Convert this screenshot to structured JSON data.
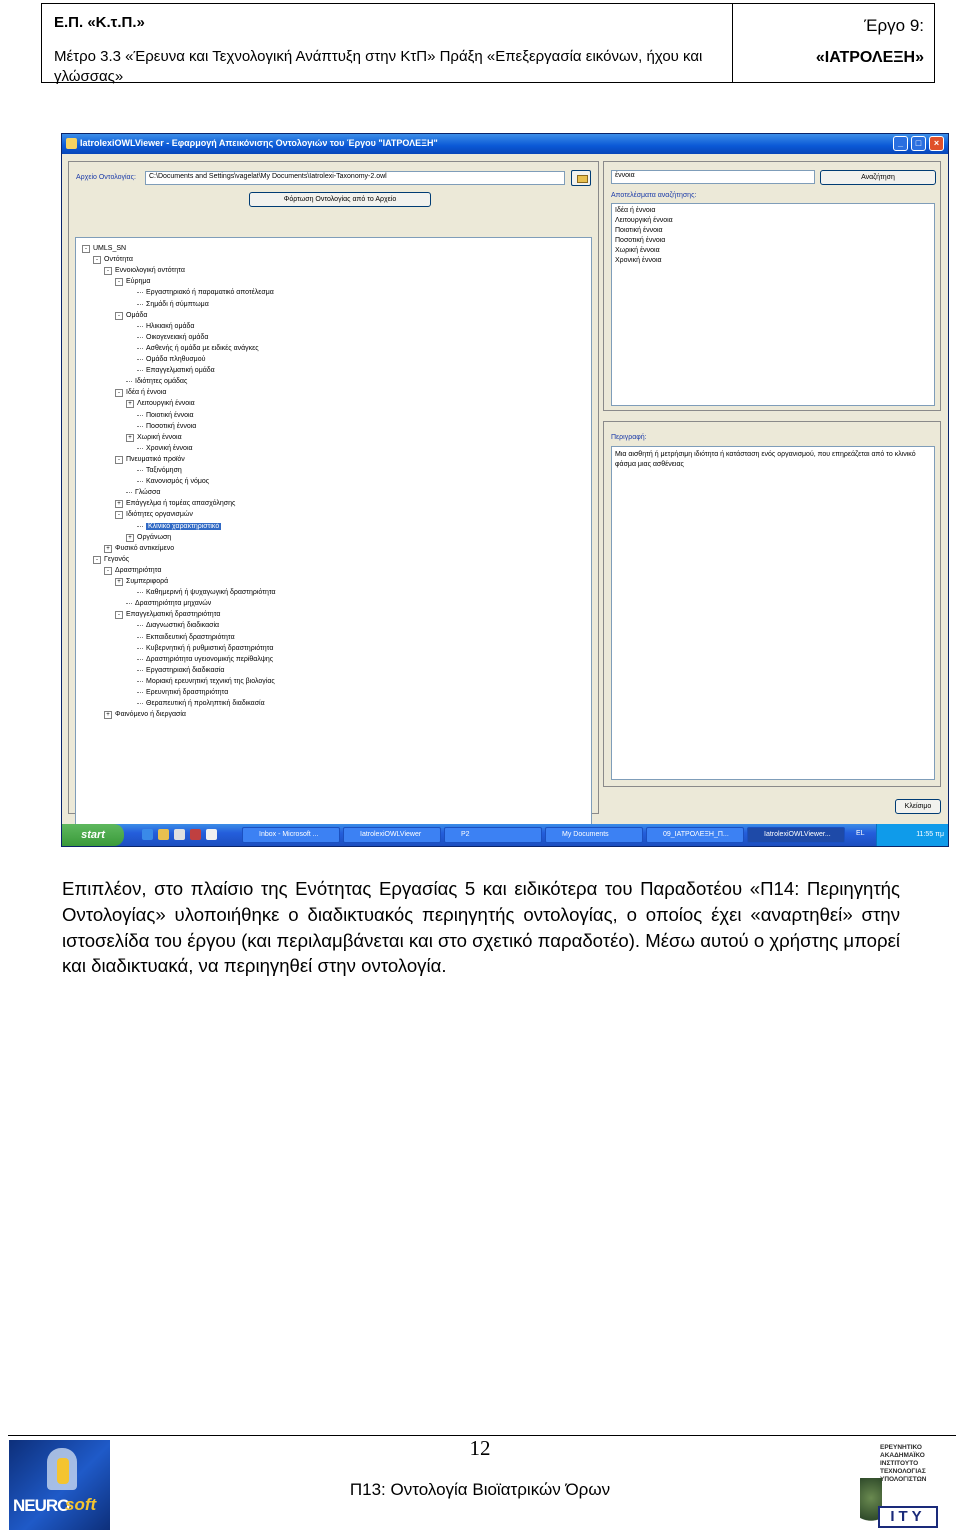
{
  "header": {
    "left_title": "Ε.Π. «Κ.τ.Π.»",
    "left_subtitle": "Μέτρο 3.3 «Έρευνα και Τεχνολογική Ανάπτυξη στην ΚτΠ» Πράξη «Επεξεργασία εικόνων, ήχου και γλώσσας»",
    "right_top": "Έργο 9:",
    "right_bottom": "«ΙΑΤΡΟΛΕΞΗ»"
  },
  "app": {
    "title": "IatrolexiOWLViewer - Εφαρμογή Απεικόνισης Οντολογιών του Έργου \"ΙΑΤΡΟΛΕΞΗ\"",
    "file_label": "Αρχείο Οντολογίας:",
    "file_path": "C:\\Documents and Settings\\vagelat\\My Documents\\Iatrolexi-Taxonomy-2.owl",
    "load_button": "Φόρτωση Οντολογίας από το Αρχείο",
    "search_value": "έννοια",
    "search_button": "Αναζήτηση",
    "results_label": "Αποτελέσματα αναζήτησης:",
    "results": [
      "Ιδέα ή έννοια",
      "Λειτουργική έννοια",
      "Ποιοτική έννοια",
      "Ποσοτική έννοια",
      "Χωρική έννοια",
      "Χρονική έννοια"
    ],
    "description_label": "Περιγραφή:",
    "description_text": "Μια αισθητή ή μετρήσιμη ιδιότητα ή κατάσταση ενός οργανισμού, που επηρεάζεται από το κλινικό φάσμα μιας ασθένειας",
    "close_button": "Κλείσιμο",
    "tree": [
      {
        "label": "UMLS_SN",
        "exp": "-"
      },
      {
        "label": "Οντότητα",
        "exp": "-"
      },
      {
        "label": "Εννοιολογική οντότητα",
        "exp": "-"
      },
      {
        "label": "Εύρημα",
        "exp": "-"
      },
      {
        "label": "Εργαστηριακό ή παραματικό αποτέλεσμα",
        "exp": ""
      },
      {
        "label": "Σημάδι ή σύμπτωμα",
        "exp": ""
      },
      {
        "label": "Ομάδα",
        "exp": "-"
      },
      {
        "label": "Ηλικιακή ομάδα",
        "exp": ""
      },
      {
        "label": "Οικογενειακή ομάδα",
        "exp": ""
      },
      {
        "label": "Ασθενής ή ομάδα με ειδικές ανάγκες",
        "exp": ""
      },
      {
        "label": "Ομάδα πληθυσμού",
        "exp": ""
      },
      {
        "label": "Επαγγελματική ομάδα",
        "exp": ""
      },
      {
        "label": "Ιδιότητες ομάδας",
        "exp": ""
      },
      {
        "label": "Ιδέα ή έννοια",
        "exp": "-"
      },
      {
        "label": "Λειτουργική έννοια",
        "exp": "+"
      },
      {
        "label": "Ποιοτική έννοια",
        "exp": ""
      },
      {
        "label": "Ποσοτική έννοια",
        "exp": ""
      },
      {
        "label": "Χωρική έννοια",
        "exp": "+"
      },
      {
        "label": "Χρονική έννοια",
        "exp": ""
      },
      {
        "label": "Πνευματικό προϊόν",
        "exp": "-"
      },
      {
        "label": "Ταξινόμηση",
        "exp": ""
      },
      {
        "label": "Κανονισμός ή νόμος",
        "exp": ""
      },
      {
        "label": "Γλώσσα",
        "exp": ""
      },
      {
        "label": "Επάγγελμα ή τομέας απασχόλησης",
        "exp": "+"
      },
      {
        "label": "Ιδιότητες οργανισμών",
        "exp": "-"
      },
      {
        "label": "Κλινικό χαρακτηριστικό",
        "exp": "",
        "selected": true
      },
      {
        "label": "Οργάνωση",
        "exp": "+"
      },
      {
        "label": "Φυσικό αντικείμενο",
        "exp": "+"
      },
      {
        "label": "Γεγονός",
        "exp": "-"
      },
      {
        "label": "Δραστηριότητα",
        "exp": "-"
      },
      {
        "label": "Συμπεριφορά",
        "exp": "+"
      },
      {
        "label": "Καθημερινή ή ψυχαγωγική δραστηριότητα",
        "exp": ""
      },
      {
        "label": "Δραστηριότητα μηχανών",
        "exp": ""
      },
      {
        "label": "Επαγγελματική δραστηριότητα",
        "exp": "-"
      },
      {
        "label": "Διαγνωστική διαδικασία",
        "exp": ""
      },
      {
        "label": "Εκπαιδευτική δραστηριότητα",
        "exp": ""
      },
      {
        "label": "Κυβερνητική ή ρυθμιστική δραστηριότητα",
        "exp": ""
      },
      {
        "label": "Δραστηριότητα υγειονομικής περίθαλψης",
        "exp": ""
      },
      {
        "label": "Εργαστηριακή διαδικασία",
        "exp": ""
      },
      {
        "label": "Μοριακή ερευνητική τεχνική της βιολογίας",
        "exp": ""
      },
      {
        "label": "Ερευνητική δραστηριότητα",
        "exp": ""
      },
      {
        "label": "Θεραπευτική ή προληπτική διαδικασία",
        "exp": ""
      },
      {
        "label": "Φαινόμενο ή διεργασία",
        "exp": "+"
      }
    ],
    "taskbar": {
      "start": "start",
      "items": [
        "Inbox - Microsoft ...",
        "IatrolexiOWLViewer",
        "P2",
        "My Documents",
        "09_ΙΑΤΡΟΛΕΞΗ_Π...",
        "IatrolexiOWLViewer..."
      ],
      "lang": "EL",
      "clock": "11:55 πμ"
    }
  },
  "body_text": "Επιπλέον, στο πλαίσιο της Ενότητας Εργασίας 5 και ειδικότερα του Παραδοτέου «Π14: Περιηγητής Οντολογίας» υλοποιήθηκε ο διαδικτυακός περιηγητής οντολογίας, ο οποίος έχει «αναρτηθεί» στην ιστοσελίδα του έργου (και περιλαμβάνεται και στο σχετικό παραδοτέο). Μέσω αυτού ο χρήστης μπορεί και διαδικτυακά, να περιηγηθεί στην οντολογία.",
  "footer": {
    "page_number": "12",
    "title": "Π13: Οντολογία Βιοϊατρικών Όρων",
    "logo_left": "NEUROSOFT",
    "logo_left_a": "NEURO",
    "logo_left_b": "soft",
    "logo_right_small": "ΕΡΕΥΝΗΤΙΚΟ ΑΚΑΔΗΜΑΪΚΟ ΙΝΣΤΙΤΟΥΤΟ ΤΕΧΝΟΛΟΓΙΑΣ ΥΠΟΛΟΓΙΣΤΩΝ",
    "logo_right_acronym": "ΙΤΥ"
  }
}
